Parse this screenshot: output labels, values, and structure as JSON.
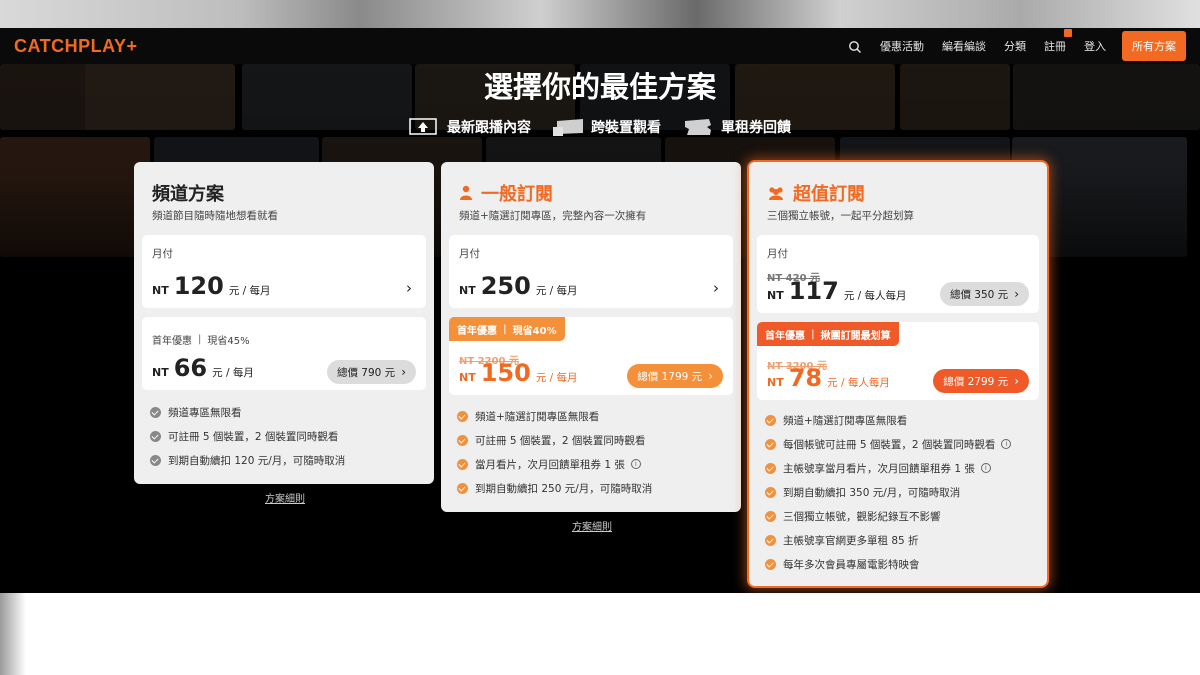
{
  "nav": {
    "logo": "CATCHPLAY+",
    "links": [
      "優惠活動",
      "編看編談",
      "分類",
      "註冊",
      "登入"
    ],
    "plans_button": "所有方案"
  },
  "hero": {
    "title": "選擇你的最佳方案",
    "features": [
      "最新跟播內容",
      "跨裝置觀看",
      "單租券回饋"
    ]
  },
  "plans": [
    {
      "title": "頻道方案",
      "subtitle": "頻道節目隨時隨地想看就看",
      "monthly": {
        "label": "月付",
        "currency": "NT",
        "amount": "120",
        "unit": "元 / 每月"
      },
      "annual": {
        "badge_a": "首年優惠",
        "badge_sep": "|",
        "badge_b": "現省45%",
        "currency": "NT",
        "amount": "66",
        "unit": "元 / 每月",
        "total": "總價 790 元"
      },
      "features": [
        "頻道專區無限看",
        "可註冊 5 個裝置，2 個裝置同時觀看",
        "到期自動續扣 120 元/月，可隨時取消"
      ],
      "rules": "方案細則"
    },
    {
      "title": "一般訂閱",
      "subtitle": "頻道+隨選訂閱專區，完整內容一次擁有",
      "monthly": {
        "label": "月付",
        "currency": "NT",
        "amount": "250",
        "unit": "元 / 每月"
      },
      "annual": {
        "badge_a": "首年優惠",
        "badge_sep": "|",
        "badge_b": "現省40%",
        "old_price": "NT 2200 元",
        "currency": "NT",
        "amount": "150",
        "unit": "元 / 每月",
        "total": "總價 1799 元"
      },
      "features": [
        "頻道+隨選訂閱專區無限看",
        "可註冊 5 個裝置，2 個裝置同時觀看",
        "當月看片，次月回饋單租券 1 張",
        "到期自動續扣 250 元/月，可隨時取消"
      ],
      "rules": "方案細則"
    },
    {
      "title": "超值訂閱",
      "subtitle": "三個獨立帳號，一起平分超划算",
      "monthly": {
        "label": "月付",
        "old_price": "NT 420 元",
        "currency": "NT",
        "amount": "117",
        "unit": "元 / 每人每月",
        "total": "總價 350 元"
      },
      "annual": {
        "badge_a": "首年優惠",
        "badge_sep": "|",
        "badge_b": "揪團訂閱最划算",
        "old_price": "NT 3200 元",
        "currency": "NT",
        "amount": "78",
        "unit": "元 / 每人每月",
        "total": "總價 2799 元"
      },
      "features": [
        "頻道+隨選訂閱專區無限看",
        "每個帳號可註冊 5 個裝置，2 個裝置同時觀看",
        "主帳號享當月看片，次月回饋單租券 1 張",
        "到期自動續扣 350 元/月，可隨時取消",
        "三個獨立帳號，觀影紀錄互不影響",
        "主帳號享官網更多單租 85 折",
        "每年多次會員專屬電影特映會"
      ]
    }
  ],
  "colors": {
    "accent": "#f26a21",
    "badge_orange": "#f5903a",
    "badge_red": "#f05a28",
    "card_bg": "#efefef"
  }
}
